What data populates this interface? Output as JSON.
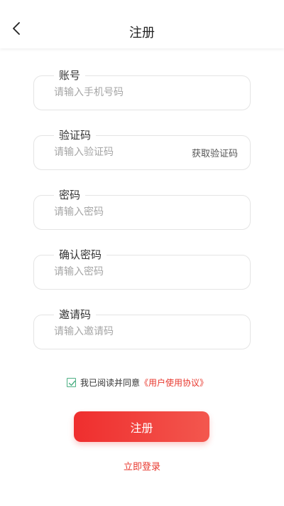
{
  "header": {
    "title": "注册"
  },
  "fields": [
    {
      "label": "账号",
      "placeholder": "请输入手机号码"
    },
    {
      "label": "验证码",
      "placeholder": "请输入验证码",
      "button": "获取验证码"
    },
    {
      "label": "密码",
      "placeholder": "请输入密码"
    },
    {
      "label": "确认密码",
      "placeholder": "请输入密码"
    },
    {
      "label": "邀请码",
      "placeholder": "请输入邀请码"
    }
  ],
  "agreement": {
    "text": "我已阅读并同意",
    "link": "《用户使用协议》",
    "checked": true
  },
  "submit_label": "注册",
  "login_link": "立即登录",
  "colors": {
    "accent": "#e8382e",
    "checkbox": "#4caf83"
  }
}
